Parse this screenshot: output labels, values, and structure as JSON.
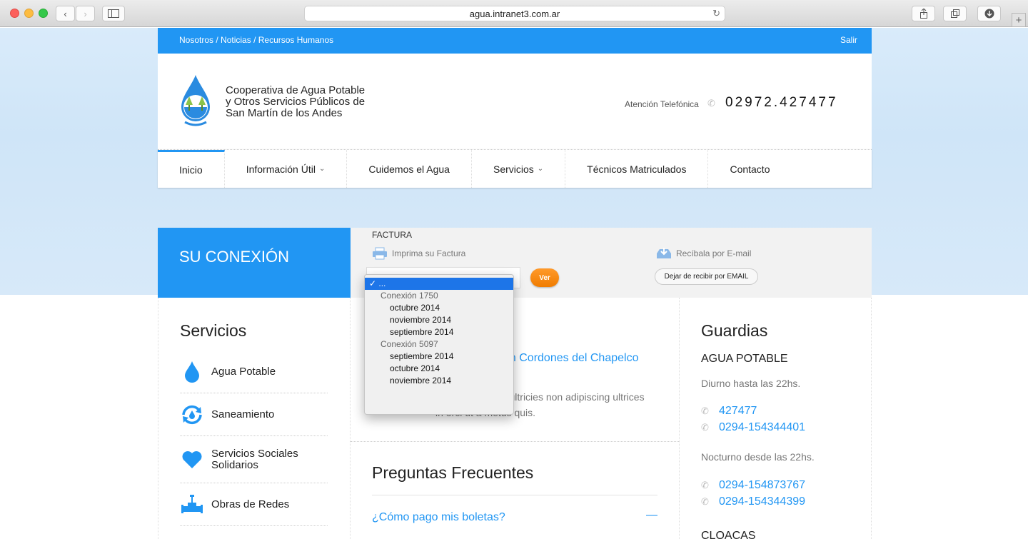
{
  "browser": {
    "url": "agua.intranet3.com.ar"
  },
  "topbar": {
    "links": [
      "Nosotros",
      "Noticias",
      "Recursos Humanos"
    ],
    "separator": " / ",
    "salir": "Salir"
  },
  "header": {
    "org_line1": "Cooperativa de Agua Potable",
    "org_line2": "y Otros Servicios Públicos de",
    "org_line3": "San Martín de los Andes",
    "atencion": "Atención Telefónica",
    "telefono": "02972.427477"
  },
  "nav": {
    "items": [
      {
        "label": "Inicio"
      },
      {
        "label": "Información Útil"
      },
      {
        "label": "Cuidemos el Agua"
      },
      {
        "label": "Servicios"
      },
      {
        "label": "Técnicos Matriculados"
      },
      {
        "label": "Contacto"
      }
    ]
  },
  "conexion": {
    "title": "SU CONEXIÓN",
    "factura_label": "FACTURA",
    "imprima": "Imprima su Factura",
    "recibala": "Recíbala por E-mail",
    "ver": "Ver",
    "dejar": "Dejar de recibir por EMAIL"
  },
  "dropdown": {
    "selected": "...",
    "groups": [
      {
        "label": "Conexión 1750",
        "options": [
          "octubre 2014",
          "noviembre 2014",
          "septiembre 2014"
        ]
      },
      {
        "label": "Conexión 5097",
        "options": [
          "septiembre 2014",
          "octubre 2014",
          "noviembre 2014"
        ]
      }
    ]
  },
  "servicios": {
    "title": "Servicios",
    "items": [
      {
        "label": "Agua Potable",
        "icon": "water-drop-icon"
      },
      {
        "label": "Saneamiento",
        "icon": "recycle-drop-icon"
      },
      {
        "label_line1": "Servicios Sociales",
        "label_line2": "Solidarios",
        "icon": "heart-icon"
      },
      {
        "label": "Obras de Redes",
        "icon": "pipe-valve-icon"
      }
    ]
  },
  "noticia": {
    "link": "en Cordones del Chapelco",
    "text": "Sed turpis tortor ultricies non adipiscing ultrices in orci ut a metus quis."
  },
  "faq": {
    "title": "Preguntas Frecuentes",
    "question": "¿Cómo pago mis boletas?",
    "toggle": "—"
  },
  "guardias": {
    "title": "Guardias",
    "agua": "AGUA POTABLE",
    "diurno": "Diurno hasta las 22hs.",
    "diurno_phones": [
      "427477",
      "0294-154344401"
    ],
    "nocturno": "Nocturno desde las 22hs.",
    "nocturno_phones": [
      "0294-154873767",
      "0294-154344399"
    ],
    "cloacas": "CLOACAS"
  },
  "colors": {
    "primary": "#2196f3",
    "orange": "#f07c00"
  }
}
